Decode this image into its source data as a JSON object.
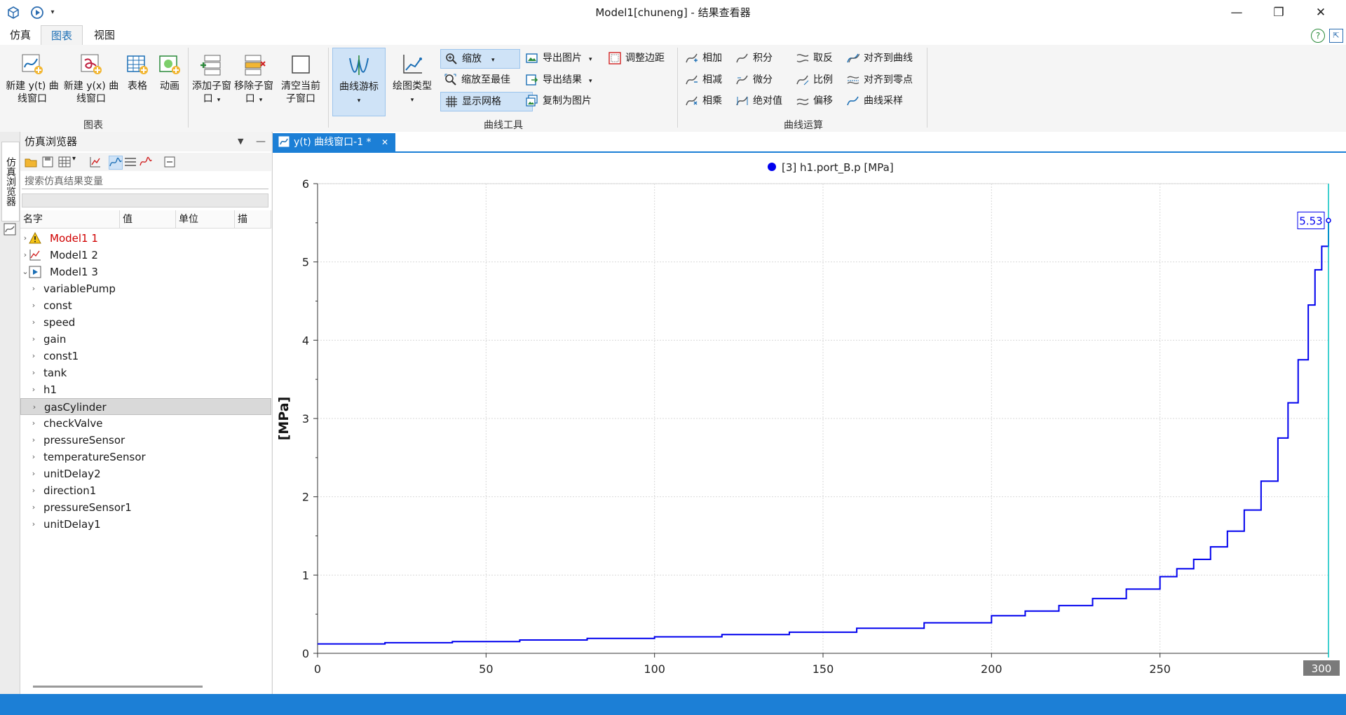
{
  "window": {
    "title": "Model1[chuneng] - 结果查看器",
    "controls": {
      "minimize": "—",
      "restore": "❐",
      "close": "✕"
    }
  },
  "menu": {
    "tabs": [
      {
        "label": "仿真"
      },
      {
        "label": "图表",
        "active": true
      },
      {
        "label": "视图"
      }
    ],
    "help_icon": "?",
    "collapse_icon": "⇱"
  },
  "ribbon": {
    "chart_group": {
      "label": "图表",
      "new_yt": "新建 y(t) 曲线窗口",
      "new_yx": "新建 y(x) 曲线窗口",
      "table": "表格",
      "animation": "动画"
    },
    "window_group": {
      "add_sub": "添加子窗口",
      "remove_sub": "移除子窗口",
      "clear_sub": "清空当前子窗口"
    },
    "curve_tools": {
      "label": "曲线工具",
      "cursor": "曲线游标",
      "plot_type": "绘图类型",
      "zoom": "缩放",
      "zoom_fit": "缩放至最佳",
      "show_grid": "显示网格",
      "export_image": "导出图片",
      "export_result": "导出结果",
      "copy_image": "复制为图片",
      "adjust_margin": "调整边距"
    },
    "curve_ops": {
      "label": "曲线运算",
      "add": "相加",
      "subtract": "相减",
      "multiply": "相乘",
      "integral": "积分",
      "derivative": "微分",
      "abs": "绝对值",
      "invert": "取反",
      "scale": "比例",
      "offset": "偏移",
      "align_curve": "对齐到曲线",
      "align_zero": "对齐到零点",
      "resample": "曲线采样"
    }
  },
  "sidebar": {
    "vertical_tab": "仿真浏览器",
    "panel_title": "仿真浏览器",
    "search_placeholder": "搜索仿真结果变量",
    "columns": [
      "名字",
      "值",
      "单位",
      "描"
    ],
    "tree": [
      {
        "label": "Model1 1",
        "status": "warning",
        "expanded": false
      },
      {
        "label": "Model1 2",
        "status": "chart",
        "expanded": false
      },
      {
        "label": "Model1 3",
        "status": "running",
        "expanded": true
      },
      {
        "label": "variablePump",
        "child": true
      },
      {
        "label": "const",
        "child": true
      },
      {
        "label": "speed",
        "child": true
      },
      {
        "label": "gain",
        "child": true
      },
      {
        "label": "const1",
        "child": true
      },
      {
        "label": "tank",
        "child": true
      },
      {
        "label": "h1",
        "child": true
      },
      {
        "label": "gasCylinder",
        "child": true,
        "selected": true
      },
      {
        "label": "checkValve",
        "child": true
      },
      {
        "label": "pressureSensor",
        "child": true
      },
      {
        "label": "temperatureSensor",
        "child": true
      },
      {
        "label": "unitDelay2",
        "child": true
      },
      {
        "label": "direction1",
        "child": true
      },
      {
        "label": "pressureSensor1",
        "child": true
      },
      {
        "label": "unitDelay1",
        "child": true
      }
    ]
  },
  "document": {
    "tab_label": "y(t) 曲线窗口-1 *",
    "tab_close": "✕"
  },
  "chart_data": {
    "type": "line",
    "title": "",
    "series": [
      {
        "name": "[3] h1.port_B.p [MPa]",
        "color": "#0000ee",
        "x": [
          0,
          20,
          40,
          60,
          80,
          100,
          120,
          140,
          160,
          180,
          200,
          210,
          220,
          230,
          240,
          250,
          255,
          260,
          265,
          270,
          275,
          280,
          285,
          288,
          291,
          294,
          296,
          298,
          300
        ],
        "y": [
          0.12,
          0.135,
          0.15,
          0.17,
          0.19,
          0.21,
          0.24,
          0.27,
          0.32,
          0.39,
          0.48,
          0.54,
          0.61,
          0.7,
          0.82,
          0.98,
          1.08,
          1.2,
          1.36,
          1.56,
          1.83,
          2.2,
          2.75,
          3.2,
          3.75,
          4.45,
          4.9,
          5.2,
          5.53
        ]
      }
    ],
    "xlabel": "",
    "ylabel": "[MPa]",
    "xlim": [
      0,
      300
    ],
    "ylim": [
      0,
      6
    ],
    "xticks": [
      0,
      50,
      100,
      150,
      200,
      250
    ],
    "yticks": [
      0,
      1,
      2,
      3,
      4,
      5,
      6
    ],
    "grid": true,
    "legend": "top-center",
    "cursor": {
      "x": 300,
      "value_label": "5.53",
      "x_label": "300",
      "color": "#00c0c0"
    }
  }
}
